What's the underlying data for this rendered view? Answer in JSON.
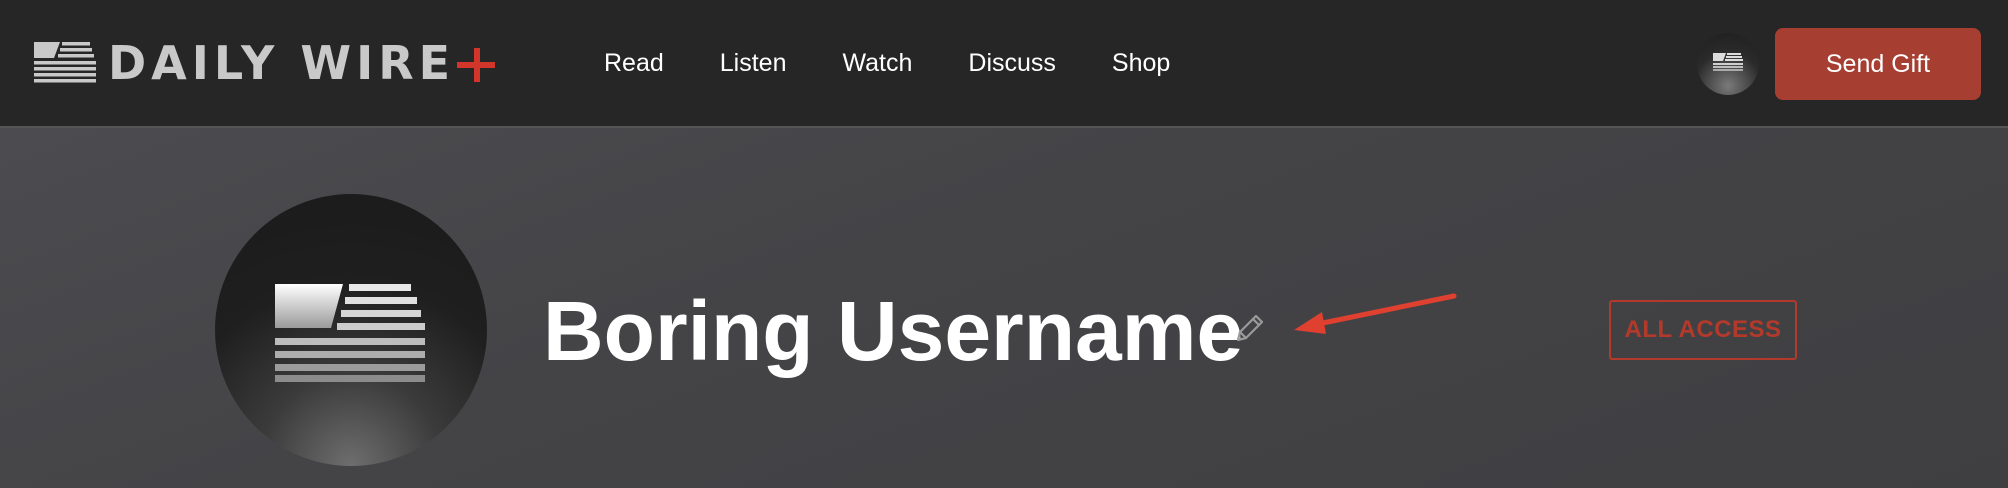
{
  "header": {
    "logo": {
      "text": "DAILY WIRE",
      "plus_color": "#d2362b"
    },
    "nav": {
      "items": [
        "Read",
        "Listen",
        "Watch",
        "Discuss",
        "Shop"
      ]
    },
    "avatar_icon": "daily-wire-flag-icon",
    "send_gift_label": "Send Gift",
    "send_gift_color": "#a63f31"
  },
  "profile": {
    "username": "Boring Username",
    "edit_icon": "pencil-icon",
    "annotation": "red-arrow",
    "badge_label": "ALL ACCESS",
    "badge_color": "#b33a2b"
  }
}
